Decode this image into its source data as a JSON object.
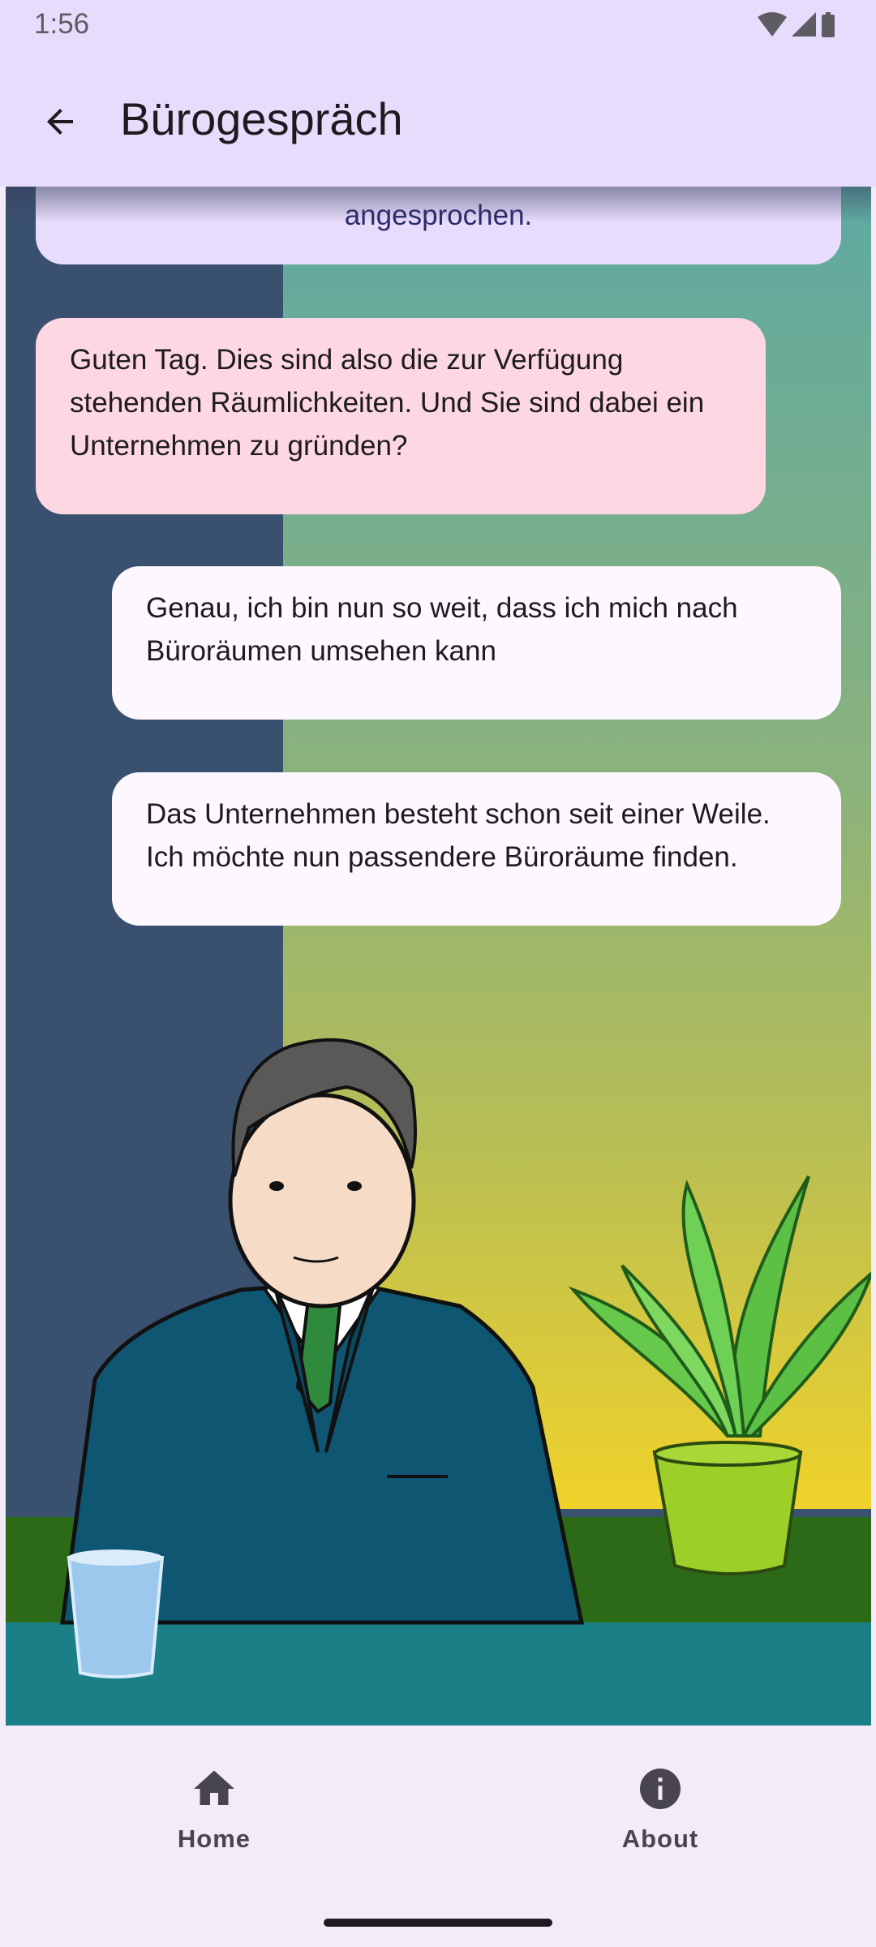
{
  "status_bar": {
    "time": "1:56"
  },
  "app_bar": {
    "title": "Bürogespräch"
  },
  "chat": {
    "partial_message": "angesprochen.",
    "partner_message": "Guten Tag. Dies sind also die zur Verfügung stehenden Räumlichkeiten. Und Sie sind dabei ein Unternehmen zu gründen?",
    "reply_options": [
      "Genau, ich bin nun so weit, dass ich mich nach Büroräumen umsehen kann",
      "Das Unternehmen besteht schon seit einer Weile. Ich möchte nun passendere Büroräume finden."
    ]
  },
  "bottom_nav": {
    "items": [
      {
        "label": "Home",
        "icon": "home-icon"
      },
      {
        "label": "About",
        "icon": "info-icon"
      }
    ]
  },
  "colors": {
    "app_bar": "#e8dcfc",
    "partner_bubble": "#fdd7e1",
    "reply_bubble": "#fdf7ff",
    "nav_background": "#f3ecf8"
  }
}
